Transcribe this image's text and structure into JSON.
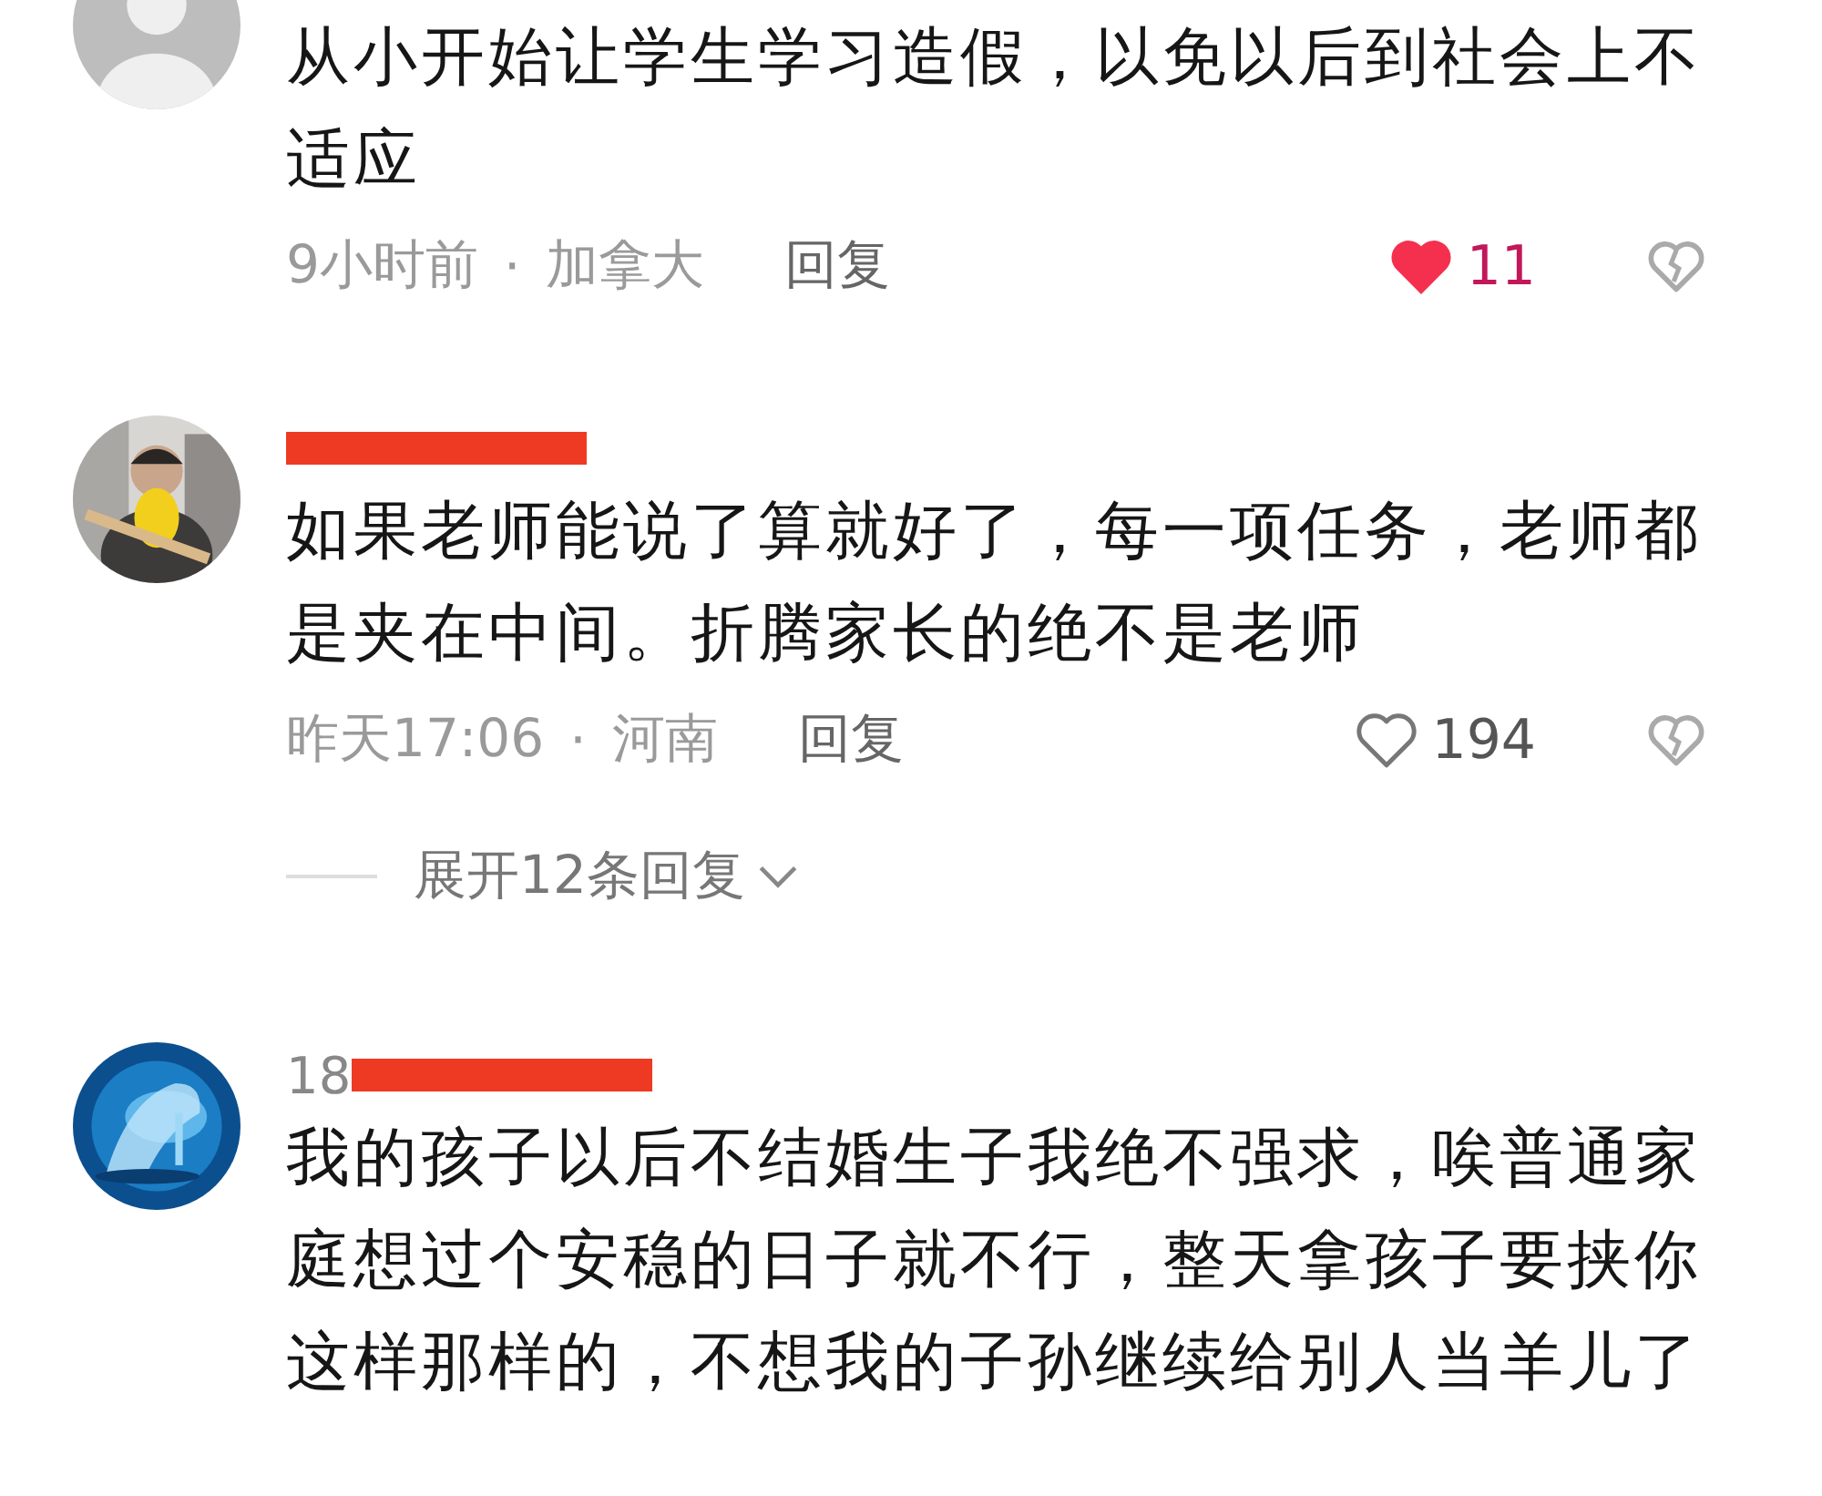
{
  "comments": [
    {
      "avatar": {
        "kind": "icon"
      },
      "text": "从小开始让学生学习造假，以免以后到社会上不适应",
      "time": "9小时前",
      "separator": "·",
      "location": "加拿大",
      "reply": "回复",
      "liked": true,
      "likes": "11"
    },
    {
      "redacted": true,
      "text": "如果老师能说了算就好了，每一项任务，老师都是夹在中间。折腾家长的绝不是老师",
      "time": "昨天17:06",
      "separator": "·",
      "location": "河南",
      "reply": "回复",
      "liked": false,
      "likes": "194",
      "expand": "展开12条回复"
    },
    {
      "username": "18",
      "redacted": true,
      "text": "我的孩子以后不结婚生子我绝不强求，唉普通家庭想过个安稳的日子就不行，整天拿孩子要挟你这样那样的，不想我的子孙继续给别人当羊儿了"
    }
  ]
}
